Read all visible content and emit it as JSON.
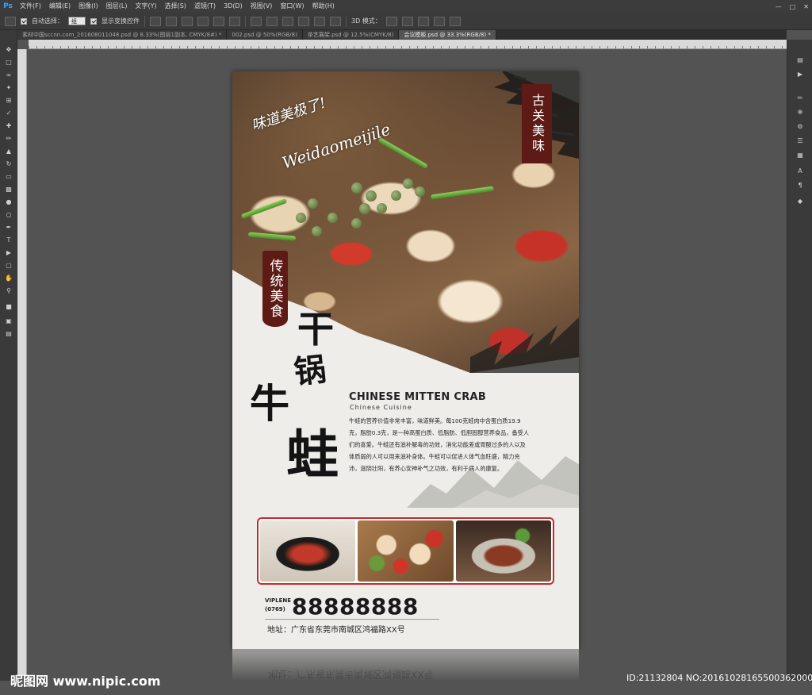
{
  "app": {
    "logo": "Ps"
  },
  "menu": [
    "文件(F)",
    "编辑(E)",
    "图像(I)",
    "图层(L)",
    "文字(Y)",
    "选择(S)",
    "滤镜(T)",
    "3D(D)",
    "视图(V)",
    "窗口(W)",
    "帮助(H)"
  ],
  "options": {
    "auto_select_label": "自动选择：",
    "auto_select_value": "组",
    "show_transform_label": "显示变换控件",
    "mode_3d_label": "3D 模式："
  },
  "tabs": [
    {
      "label": "素材中国sccnn.com_201608011048.psd @ 8.33%(图层1副本, CMYK/8#) *",
      "active": false
    },
    {
      "label": "002.psd @ 50%(RGB/8)",
      "active": false
    },
    {
      "label": "茶艺展架.psd @ 12.5%(CMYK/8)",
      "active": false
    },
    {
      "label": "会议模板.psd @ 33.3%(RGB/8) *",
      "active": true
    }
  ],
  "poster": {
    "slogan_cn": "味道美极了!",
    "slogan_pinyin": "Weidaomeijile",
    "badge_right": "古关美味",
    "badge_left": "传统美食",
    "title_chars": {
      "gan": "干",
      "guo": "锅",
      "niu": "牛",
      "wa": "蛙"
    },
    "english_title": "CHINESE MITTEN CRAB",
    "english_sub": "Chinese  Cuisine",
    "description": "牛蛙的营养价值非常丰富，味道鲜美。每100克蛙肉中含蛋白质19.9克，脂肪0.3克，是一种高蛋白质、低脂肪、低胆固醇营养食品，备受人们的喜爱。牛蛙还有滋补解毒的功效，消化功能差或胃酸过多的人以及体质弱的人可以用来滋补身体。牛蛙可以促进人体气血旺盛，精力充沛，滋阴壮阳，有养心安神补气之功效，有利于病人的康复。",
    "viplene_label": "VIPLENE",
    "area_code": "(0769)",
    "phone": "88888888",
    "address": "地址：广东省东莞市南城区鸿福路XX号"
  },
  "watermarks": {
    "left": "昵图网 www.nipic.com",
    "right": "ID:21132804 NO:20161028165500362000"
  }
}
